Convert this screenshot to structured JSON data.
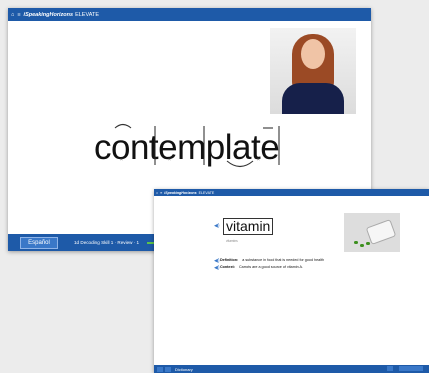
{
  "win1": {
    "header": {
      "brand": "iSpeakingHorizons",
      "title": "ELEVATE"
    },
    "word": "contemplate",
    "footer": {
      "lang": "Español",
      "status": "1d Decoding Skill 1 · Review · 1"
    }
  },
  "win2": {
    "header": {
      "brand": "iSpeakingHorizons",
      "title": "ELEVATE"
    },
    "word": "vitamin",
    "word_sub": "vitamins",
    "definition": {
      "label": "Definition:",
      "text": "a substance in food that is needed for good health"
    },
    "context": {
      "label": "Context:",
      "text": "Carrots are a good source of vitamin A."
    },
    "footer": {
      "dictionary": "Dictionary"
    }
  },
  "colors": {
    "accent": "#1e5aa8",
    "button": "#3a78c8",
    "progress": "#5cc24a"
  }
}
